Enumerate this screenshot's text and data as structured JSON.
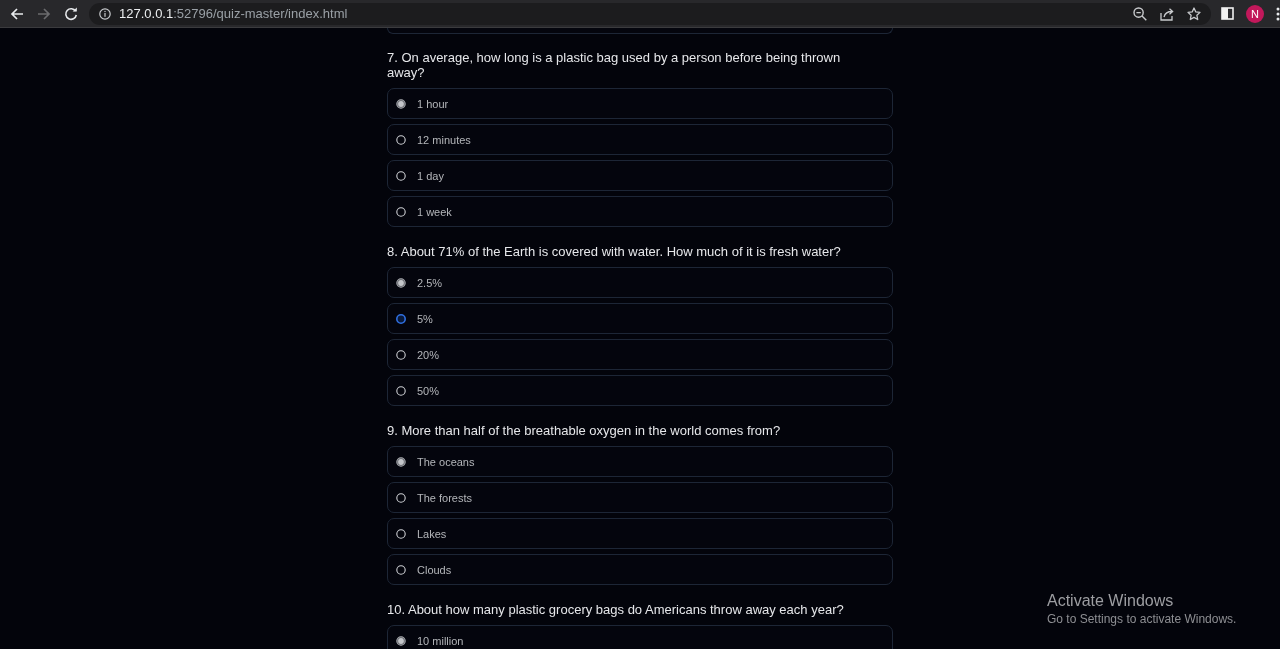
{
  "browser": {
    "back_disabled": false,
    "forward_disabled": true,
    "url": {
      "host": "127.0.0.1",
      "path": ":52796/quiz-master/index.html"
    },
    "profile_initial": "N"
  },
  "questions": [
    {
      "text": "7. On average, how long is a plastic bag used by a person before being thrown away?",
      "options": [
        {
          "label": "1 hour",
          "selected": true,
          "focused": false
        },
        {
          "label": "12 minutes",
          "selected": false,
          "focused": false
        },
        {
          "label": "1 day",
          "selected": false,
          "focused": false
        },
        {
          "label": "1 week",
          "selected": false,
          "focused": false
        }
      ]
    },
    {
      "text": "8. About 71% of the Earth is covered with water. How much of it is fresh water?",
      "options": [
        {
          "label": "2.5%",
          "selected": true,
          "focused": false
        },
        {
          "label": "5%",
          "selected": false,
          "focused": true
        },
        {
          "label": "20%",
          "selected": false,
          "focused": false
        },
        {
          "label": "50%",
          "selected": false,
          "focused": false
        }
      ]
    },
    {
      "text": "9. More than half of the breathable oxygen in the world comes from?",
      "options": [
        {
          "label": "The oceans",
          "selected": true,
          "focused": false
        },
        {
          "label": "The forests",
          "selected": false,
          "focused": false
        },
        {
          "label": "Lakes",
          "selected": false,
          "focused": false
        },
        {
          "label": "Clouds",
          "selected": false,
          "focused": false
        }
      ]
    },
    {
      "text": "10. About how many plastic grocery bags do Americans throw away each year?",
      "options": [
        {
          "label": "10 million",
          "selected": true,
          "focused": false
        }
      ]
    }
  ],
  "os_notice": {
    "title": "Activate Windows",
    "subtitle": "Go to Settings to activate Windows."
  }
}
